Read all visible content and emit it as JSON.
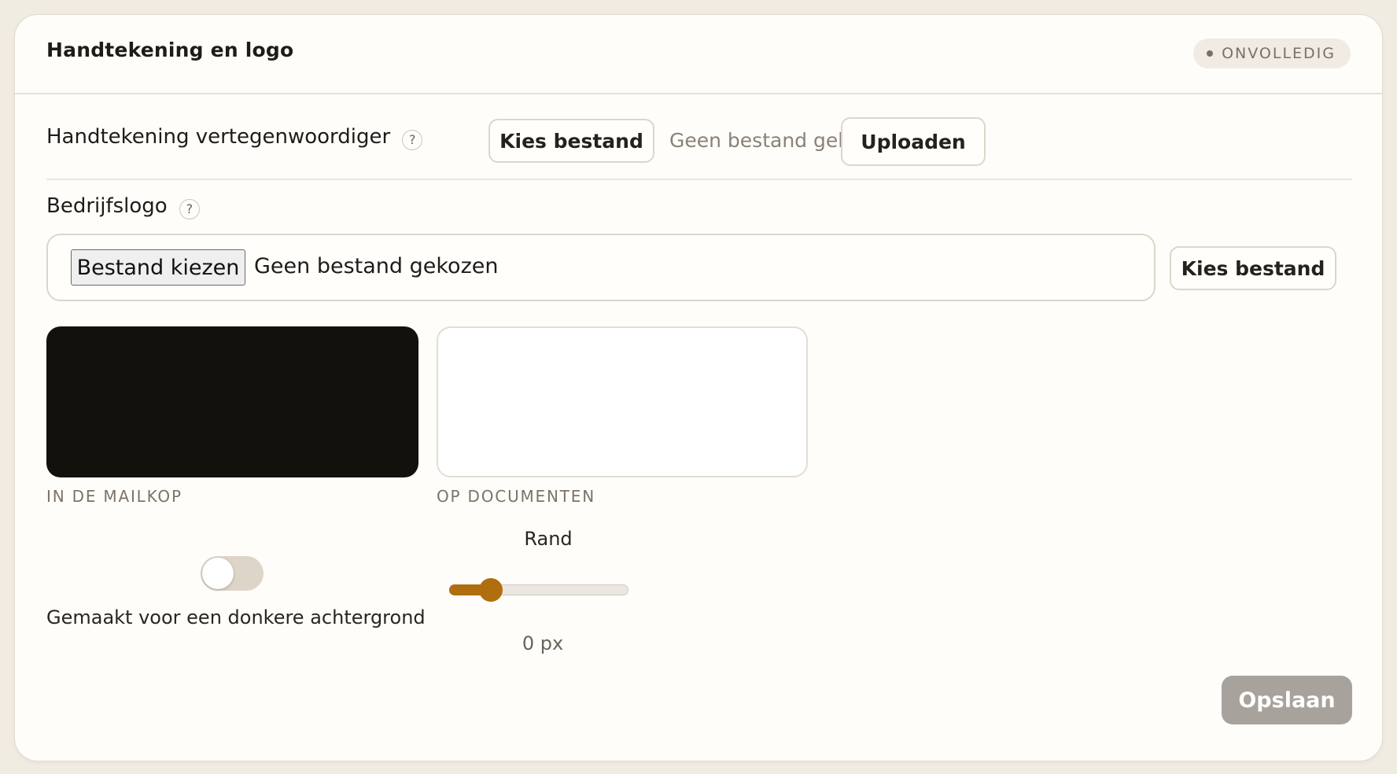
{
  "header": {
    "title": "Handtekening en logo",
    "status_badge": "ONVOLLEDIG"
  },
  "signature": {
    "label": "Handtekening vertegenwoordiger",
    "help": "?",
    "choose_button": "Kies bestand",
    "file_status": "Geen bestand geko...",
    "upload_button": "Uploaden"
  },
  "logo": {
    "label": "Bedrijfslogo",
    "help": "?",
    "native_button": "Bestand kiezen",
    "native_status": "Geen bestand gekozen",
    "choose_button": "Kies bestand"
  },
  "previews": {
    "mail_header_caption": "IN DE MAILKOP",
    "documents_caption": "OP DOCUMENTEN"
  },
  "dark_background": {
    "label": "Gemaakt voor een donkere achtergrond",
    "enabled": false
  },
  "border": {
    "label": "Rand",
    "value_text": "0 px",
    "slider_fraction": 0.19
  },
  "actions": {
    "save_button": "Opslaan"
  },
  "colors": {
    "accent": "#b06e0e",
    "card_background": "#fefdfa",
    "page_background": "#f1ece2",
    "dark_preview": "#13110b"
  }
}
